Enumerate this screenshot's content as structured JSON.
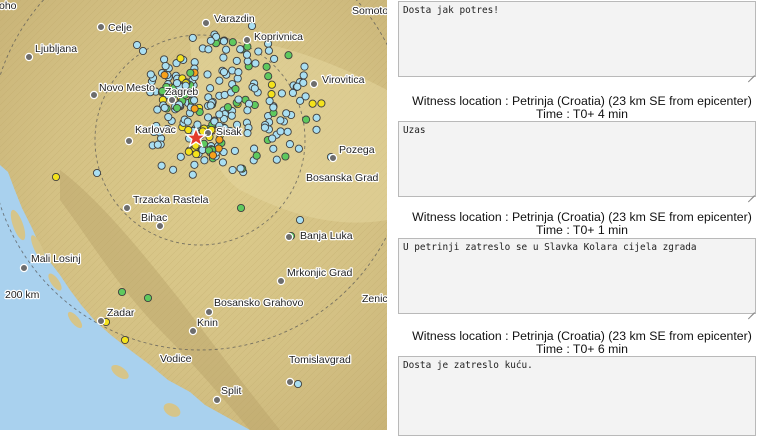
{
  "map": {
    "places": [
      {
        "key": "celje",
        "label": "Celje"
      },
      {
        "key": "varazdin",
        "label": "Varazdin"
      },
      {
        "key": "somotor",
        "label": "Somotor"
      },
      {
        "key": "koprivnica",
        "label": "Koprivnica"
      },
      {
        "key": "ljubljana",
        "label": "Ljubljana"
      },
      {
        "key": "virovitica",
        "label": "Virovitica"
      },
      {
        "key": "novo_mesto",
        "label": "Novo Mesto"
      },
      {
        "key": "zagreb",
        "label": "Zagreb"
      },
      {
        "key": "karlovac",
        "label": "Karlovac"
      },
      {
        "key": "sisak",
        "label": "Sisak"
      },
      {
        "key": "pozega",
        "label": "Pozega"
      },
      {
        "key": "bosanska_gradiska",
        "label": "Bosanska Grad"
      },
      {
        "key": "trzacka_rastela",
        "label": "Trzacka Rastela"
      },
      {
        "key": "bihac",
        "label": "Bihac"
      },
      {
        "key": "banja_luka",
        "label": "Banja Luka"
      },
      {
        "key": "mali_losinj",
        "label": "Mali Losinj"
      },
      {
        "key": "mrkonjic_grad",
        "label": "Mrkonjic Grad"
      },
      {
        "key": "bosansko_grahovo",
        "label": "Bosansko Grahovo"
      },
      {
        "key": "zadar",
        "label": "Zadar"
      },
      {
        "key": "knin",
        "label": "Knin"
      },
      {
        "key": "vodice",
        "label": "Vodice"
      },
      {
        "key": "tomislavgrad",
        "label": "Tomislavgrad"
      },
      {
        "key": "split",
        "label": "Split"
      },
      {
        "key": "zenica",
        "label": "Zenic"
      },
      {
        "key": "koho",
        "label": "oho"
      }
    ],
    "distance_label": "200 km",
    "colors": {
      "sea": "#a9d1ee",
      "land": "#d9c98c",
      "report_blue": "#a9dff2",
      "report_yellow": "#f4e21c",
      "report_green": "#5ec95e",
      "report_orange": "#f7a11b",
      "epicenter_star": "#e33b2d"
    },
    "icons": [
      "epicenter-star-icon",
      "intensity-report-dot-icon",
      "city-marker-icon"
    ]
  },
  "reports": [
    {
      "comment": "Dosta jak potres!",
      "witness": null,
      "time": null
    },
    {
      "comment": "Uzas",
      "witness": "Witness location : Petrinja (Croatia) (23 km SE from epicenter)",
      "time": "Time : T0+ 4 min"
    },
    {
      "comment": "U petrinji zatreslo se u Slavka Kolara cijela zgrada",
      "witness": "Witness location : Petrinja (Croatia) (23 km SE from epicenter)",
      "time": "Time : T0+ 1 min"
    },
    {
      "comment": "Dosta je zatreslo kuću.",
      "witness": "Witness location : Petrinja (Croatia) (23 km SE from epicenter)",
      "time": "Time : T0+ 6 min"
    }
  ]
}
